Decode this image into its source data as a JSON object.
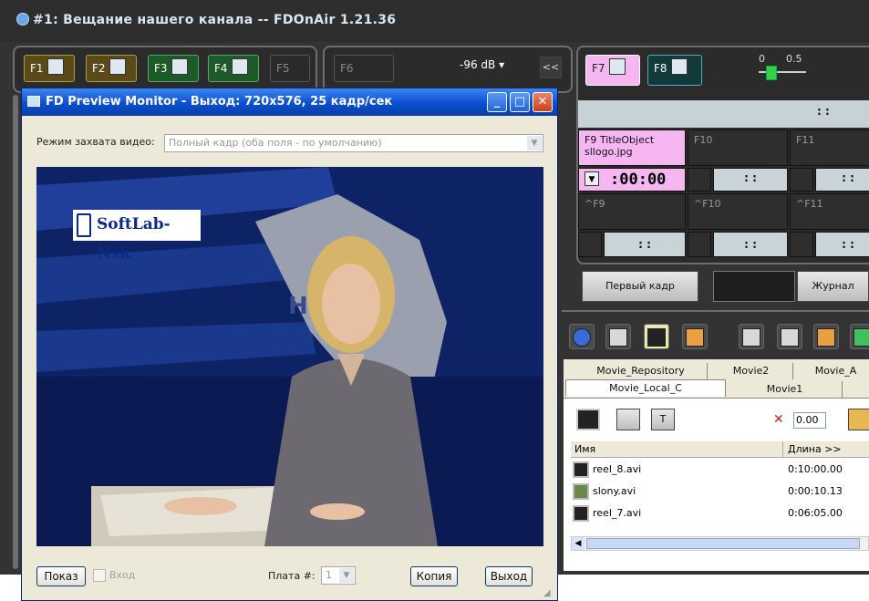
{
  "app": {
    "title": "#1: Вещание нашего канала -- FDOnAir 1.21.36"
  },
  "left_panel": {
    "fkeys": [
      "F1",
      "F2",
      "F3",
      "F4",
      "F5"
    ],
    "f6": "F6",
    "level": "-96 dB",
    "collapse": "<<"
  },
  "right_panel": {
    "f7": "F7",
    "f8": "F8",
    "scale": [
      "0",
      "0.5"
    ],
    "time_blank": ":   :",
    "f9_label": "F9  TitleObject",
    "f9_file": "sllogo.jpg",
    "f10": "F10",
    "f11": "F11",
    "timecode": ":00:00",
    "sf9": "^F9",
    "sf10": "^F10",
    "sf11": "^F11",
    "first_frame": "Первый кадр",
    "journal": "Журнал"
  },
  "library": {
    "tabs_row1": [
      "Movie_Repository",
      "Movie2",
      "Movie_A"
    ],
    "tabs_row2": [
      "Movie_Local_C",
      "Movie1"
    ],
    "speed": "0.00",
    "columns": [
      "Имя",
      "Длина >>"
    ],
    "rows": [
      {
        "name": "reel_8.avi",
        "length": "0:10:00.00"
      },
      {
        "name": "slony.avi",
        "length": "0:00:10.13"
      },
      {
        "name": "reel_7.avi",
        "length": "0:06:05.00"
      }
    ]
  },
  "dialog": {
    "title": "FD Preview Monitor - Выход: 720x576, 25 кадр/сек",
    "capture_label": "Режим захвата видео:",
    "capture_value": "Полный кадр (оба поля - по умолчанию)",
    "show_button": "Показ",
    "input_checkbox": "Вход",
    "board_label": "Плата #:",
    "board_value": "1",
    "copy_button": "Копия",
    "exit_button": "Выход",
    "video_logo": "SoftLab-Nsk",
    "bg_letters": "Н"
  }
}
